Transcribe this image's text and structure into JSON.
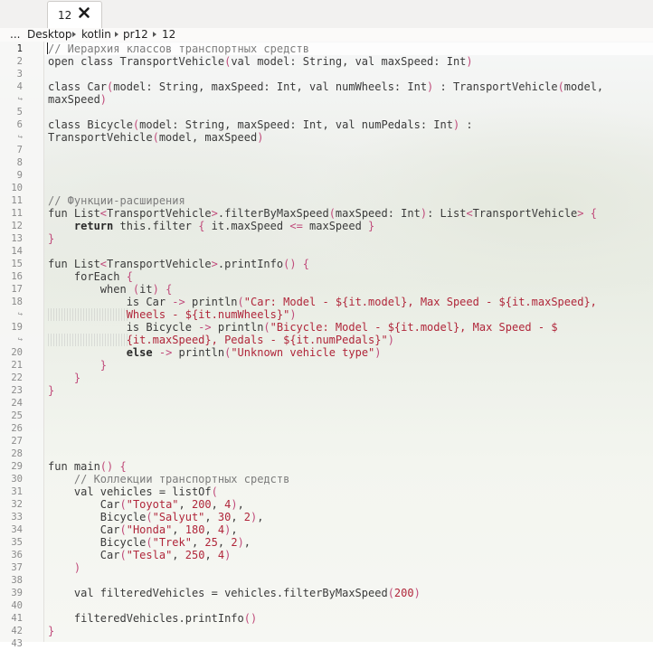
{
  "tab": {
    "label": "12"
  },
  "breadcrumb": [
    "...",
    "Desktop",
    "kotlin",
    "pr12",
    "12"
  ],
  "editor": {
    "current_line": 1,
    "rows": [
      {
        "n": "1",
        "t": [
          [
            "c",
            "// Иерархия классов транспортных средств"
          ]
        ]
      },
      {
        "n": "2",
        "t": [
          [
            "p",
            "open class TransportVehicle"
          ],
          [
            "b",
            "("
          ],
          [
            "p",
            "val model: String, val maxSpeed: Int"
          ],
          [
            "b",
            ")"
          ]
        ]
      },
      {
        "n": "3",
        "t": []
      },
      {
        "n": "4",
        "t": [
          [
            "p",
            "class Car"
          ],
          [
            "b",
            "("
          ],
          [
            "p",
            "model: String, maxSpeed: Int, val numWheels: Int"
          ],
          [
            "b",
            ")"
          ],
          [
            "p",
            " : TransportVehicle"
          ],
          [
            "b",
            "("
          ],
          [
            "p",
            "model,"
          ]
        ]
      },
      {
        "n": "",
        "w": true,
        "t": [
          [
            "p",
            "maxSpeed"
          ],
          [
            "b",
            ")"
          ]
        ]
      },
      {
        "n": "5",
        "t": []
      },
      {
        "n": "6",
        "t": [
          [
            "p",
            "class Bicycle"
          ],
          [
            "b",
            "("
          ],
          [
            "p",
            "model: String, maxSpeed: Int, val numPedals: Int"
          ],
          [
            "b",
            ")"
          ],
          [
            "p",
            " :"
          ]
        ]
      },
      {
        "n": "",
        "w": true,
        "t": [
          [
            "p",
            "TransportVehicle"
          ],
          [
            "b",
            "("
          ],
          [
            "p",
            "model, maxSpeed"
          ],
          [
            "b",
            ")"
          ]
        ]
      },
      {
        "n": "7",
        "t": []
      },
      {
        "n": "8",
        "t": []
      },
      {
        "n": "9",
        "t": []
      },
      {
        "n": "10",
        "t": []
      },
      {
        "n": "11",
        "t": [
          [
            "c",
            "// Функции-расширения"
          ]
        ]
      },
      {
        "n": "11",
        "t": [
          [
            "p",
            "fun List"
          ],
          [
            "b",
            "<"
          ],
          [
            "p",
            "TransportVehicle"
          ],
          [
            "b",
            ">"
          ],
          [
            "p",
            ".filterByMaxSpeed"
          ],
          [
            "b",
            "("
          ],
          [
            "p",
            "maxSpeed: Int"
          ],
          [
            "b",
            ")"
          ],
          [
            "p",
            ": List"
          ],
          [
            "b",
            "<"
          ],
          [
            "p",
            "TransportVehicle"
          ],
          [
            "b",
            ">"
          ],
          [
            "p",
            " "
          ],
          [
            "b",
            "{"
          ]
        ]
      },
      {
        "n": "12",
        "t": [
          [
            "p",
            "    "
          ],
          [
            "k",
            "return"
          ],
          [
            "p",
            " this.filter "
          ],
          [
            "b",
            "{"
          ],
          [
            "p",
            " it.maxSpeed "
          ],
          [
            "b",
            "<="
          ],
          [
            "p",
            " maxSpeed "
          ],
          [
            "b",
            "}"
          ]
        ]
      },
      {
        "n": "13",
        "t": [
          [
            "b",
            "}"
          ]
        ]
      },
      {
        "n": "14",
        "t": []
      },
      {
        "n": "15",
        "t": [
          [
            "p",
            "fun List"
          ],
          [
            "b",
            "<"
          ],
          [
            "p",
            "TransportVehicle"
          ],
          [
            "b",
            ">"
          ],
          [
            "p",
            ".printInfo"
          ],
          [
            "b",
            "()"
          ],
          [
            "p",
            " "
          ],
          [
            "b",
            "{"
          ]
        ]
      },
      {
        "n": "16",
        "t": [
          [
            "p",
            "    forEach "
          ],
          [
            "b",
            "{"
          ]
        ]
      },
      {
        "n": "17",
        "t": [
          [
            "p",
            "        when "
          ],
          [
            "b",
            "("
          ],
          [
            "p",
            "it"
          ],
          [
            "b",
            ")"
          ],
          [
            "p",
            " "
          ],
          [
            "b",
            "{"
          ]
        ]
      },
      {
        "n": "18",
        "t": [
          [
            "p",
            "            is Car "
          ],
          [
            "b",
            "->"
          ],
          [
            "p",
            " println"
          ],
          [
            "b",
            "("
          ],
          [
            "s",
            "\"Car: Model - ${it.model}, Max Speed - ${it.maxSpeed},"
          ]
        ]
      },
      {
        "n": "",
        "w": true,
        "h": true,
        "t": [
          [
            "p",
            "            "
          ],
          [
            "s",
            "Wheels - ${it.numWheels}\""
          ],
          [
            "b",
            ")"
          ]
        ]
      },
      {
        "n": "19",
        "t": [
          [
            "p",
            "            is Bicycle "
          ],
          [
            "b",
            "->"
          ],
          [
            "p",
            " println"
          ],
          [
            "b",
            "("
          ],
          [
            "s",
            "\"Bicycle: Model - ${it.model}, Max Speed - $"
          ]
        ]
      },
      {
        "n": "",
        "w": true,
        "h": true,
        "t": [
          [
            "p",
            "            "
          ],
          [
            "s",
            "{it.maxSpeed}, Pedals - ${it.numPedals}\""
          ],
          [
            "b",
            ")"
          ]
        ]
      },
      {
        "n": "20",
        "t": [
          [
            "p",
            "            "
          ],
          [
            "k",
            "else"
          ],
          [
            "p",
            " "
          ],
          [
            "b",
            "->"
          ],
          [
            "p",
            " println"
          ],
          [
            "b",
            "("
          ],
          [
            "s",
            "\"Unknown vehicle type\""
          ],
          [
            "b",
            ")"
          ]
        ]
      },
      {
        "n": "21",
        "t": [
          [
            "p",
            "        "
          ],
          [
            "b",
            "}"
          ]
        ]
      },
      {
        "n": "22",
        "t": [
          [
            "p",
            "    "
          ],
          [
            "b",
            "}"
          ]
        ]
      },
      {
        "n": "23",
        "t": [
          [
            "b",
            "}"
          ]
        ]
      },
      {
        "n": "24",
        "t": []
      },
      {
        "n": "25",
        "t": []
      },
      {
        "n": "26",
        "t": []
      },
      {
        "n": "27",
        "t": []
      },
      {
        "n": "28",
        "t": []
      },
      {
        "n": "29",
        "t": [
          [
            "p",
            "fun main"
          ],
          [
            "b",
            "()"
          ],
          [
            "p",
            " "
          ],
          [
            "b",
            "{"
          ]
        ]
      },
      {
        "n": "30",
        "t": [
          [
            "p",
            "    "
          ],
          [
            "c",
            "// Коллекции транспортных средств"
          ]
        ]
      },
      {
        "n": "31",
        "t": [
          [
            "p",
            "    val vehicles = listOf"
          ],
          [
            "b",
            "("
          ]
        ]
      },
      {
        "n": "32",
        "t": [
          [
            "p",
            "        Car"
          ],
          [
            "b",
            "("
          ],
          [
            "s",
            "\"Toyota\""
          ],
          [
            "p",
            ", "
          ],
          [
            "n",
            "200"
          ],
          [
            "p",
            ", "
          ],
          [
            "n",
            "4"
          ],
          [
            "b",
            ")"
          ],
          [
            "p",
            ","
          ]
        ]
      },
      {
        "n": "33",
        "t": [
          [
            "p",
            "        Bicycle"
          ],
          [
            "b",
            "("
          ],
          [
            "s",
            "\"Salyut\""
          ],
          [
            "p",
            ", "
          ],
          [
            "n",
            "30"
          ],
          [
            "p",
            ", "
          ],
          [
            "n",
            "2"
          ],
          [
            "b",
            ")"
          ],
          [
            "p",
            ","
          ]
        ]
      },
      {
        "n": "34",
        "t": [
          [
            "p",
            "        Car"
          ],
          [
            "b",
            "("
          ],
          [
            "s",
            "\"Honda\""
          ],
          [
            "p",
            ", "
          ],
          [
            "n",
            "180"
          ],
          [
            "p",
            ", "
          ],
          [
            "n",
            "4"
          ],
          [
            "b",
            ")"
          ],
          [
            "p",
            ","
          ]
        ]
      },
      {
        "n": "35",
        "t": [
          [
            "p",
            "        Bicycle"
          ],
          [
            "b",
            "("
          ],
          [
            "s",
            "\"Trek\""
          ],
          [
            "p",
            ", "
          ],
          [
            "n",
            "25"
          ],
          [
            "p",
            ", "
          ],
          [
            "n",
            "2"
          ],
          [
            "b",
            ")"
          ],
          [
            "p",
            ","
          ]
        ]
      },
      {
        "n": "36",
        "t": [
          [
            "p",
            "        Car"
          ],
          [
            "b",
            "("
          ],
          [
            "s",
            "\"Tesla\""
          ],
          [
            "p",
            ", "
          ],
          [
            "n",
            "250"
          ],
          [
            "p",
            ", "
          ],
          [
            "n",
            "4"
          ],
          [
            "b",
            ")"
          ]
        ]
      },
      {
        "n": "37",
        "t": [
          [
            "p",
            "    "
          ],
          [
            "b",
            ")"
          ]
        ]
      },
      {
        "n": "38",
        "t": []
      },
      {
        "n": "39",
        "t": [
          [
            "p",
            "    val filteredVehicles = vehicles.filterByMaxSpeed"
          ],
          [
            "b",
            "("
          ],
          [
            "n",
            "200"
          ],
          [
            "b",
            ")"
          ]
        ]
      },
      {
        "n": "40",
        "t": []
      },
      {
        "n": "41",
        "t": [
          [
            "p",
            "    filteredVehicles.printInfo"
          ],
          [
            "b",
            "()"
          ]
        ]
      },
      {
        "n": "42",
        "t": [
          [
            "b",
            "}"
          ]
        ]
      },
      {
        "n": "43",
        "t": []
      }
    ]
  },
  "colors": {
    "comment": "#7c7c7c",
    "string": "#b0263a",
    "bracket": "#c04a7a",
    "keyword": "#2a2a2a"
  },
  "icons": {
    "tab_close": "close-icon",
    "crumb_separator": "chevron-right-icon"
  }
}
